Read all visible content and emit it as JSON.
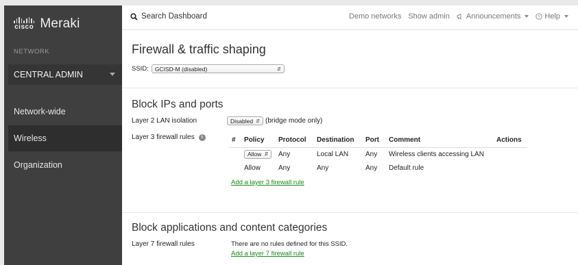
{
  "sidebar": {
    "logo": {
      "brand": "cisco",
      "product": "Meraki"
    },
    "network_label": "NETWORK",
    "network_selected": "CENTRAL ADMIN",
    "items": [
      {
        "label": "Network-wide"
      },
      {
        "label": "Wireless"
      },
      {
        "label": "Organization"
      }
    ]
  },
  "topbar": {
    "search_placeholder": "Search Dashboard",
    "links": {
      "demo": "Demo networks",
      "show_admin": "Show admin",
      "announcements": "Announcements",
      "help": "Help"
    }
  },
  "main": {
    "title": "Firewall & traffic shaping",
    "ssid_label": "SSID:",
    "ssid_value": "GCISD-M (disabled)",
    "block_ips": {
      "title": "Block IPs and ports",
      "l2_label": "Layer 2 LAN isolation",
      "l2_value": "Disabled",
      "l2_note": "(bridge mode only)",
      "l3_label": "Layer 3 firewall rules",
      "table": {
        "headers": [
          "#",
          "Policy",
          "Protocol",
          "Destination",
          "Port",
          "Comment",
          "Actions"
        ],
        "rows": [
          {
            "num": "",
            "policy": "Allow",
            "protocol": "Any",
            "destination": "Local LAN",
            "port": "Any",
            "comment": "Wireless clients accessing LAN",
            "actions": ""
          },
          {
            "num": "",
            "policy": "Allow",
            "protocol": "Any",
            "destination": "Any",
            "port": "Any",
            "comment": "Default rule",
            "actions": ""
          }
        ]
      },
      "add_l3": "Add a layer 3 firewall rule"
    },
    "block_apps": {
      "title": "Block applications and content categories",
      "l7_label": "Layer 7 firewall rules",
      "l7_note": "There are no rules defined for this SSID.",
      "add_l7": "Add a layer 7 firewall rule"
    }
  }
}
